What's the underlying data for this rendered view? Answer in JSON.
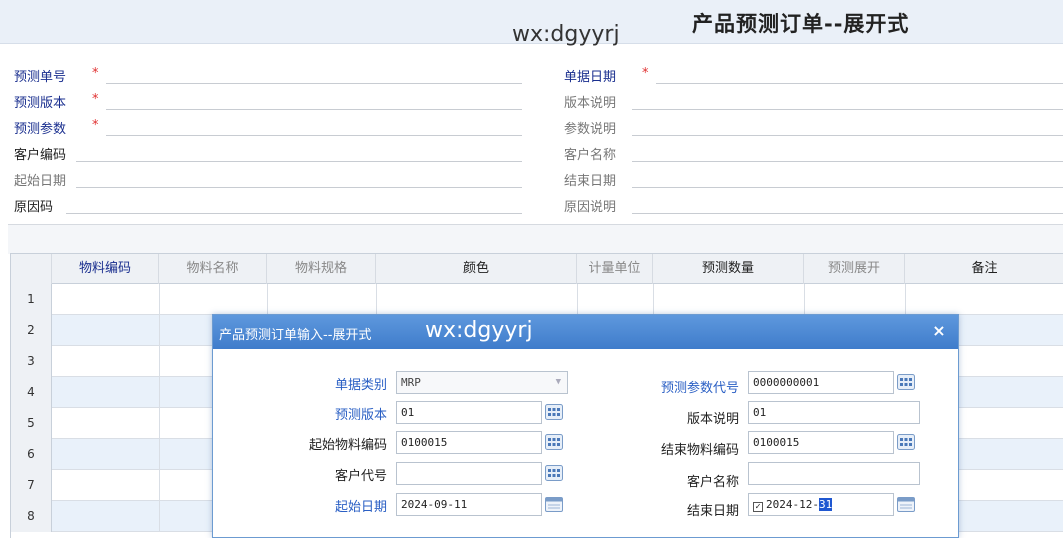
{
  "header": {
    "watermark": "wx:dgyyrj",
    "title": "产品预测订单--展开式"
  },
  "form": {
    "left": [
      {
        "label": "预测单号",
        "required": true
      },
      {
        "label": "预测版本",
        "required": true
      },
      {
        "label": "预测参数",
        "required": true
      },
      {
        "label": "客户编码",
        "required": false
      },
      {
        "label": "起始日期",
        "required": false
      },
      {
        "label": "原因码",
        "required": false
      }
    ],
    "right": [
      {
        "label": "单据日期",
        "required": true
      },
      {
        "label": "版本说明",
        "required": false
      },
      {
        "label": "参数说明",
        "required": false
      },
      {
        "label": "客户名称",
        "required": false
      },
      {
        "label": "结束日期",
        "required": false
      },
      {
        "label": "原因说明",
        "required": false
      }
    ],
    "required_mark": "*"
  },
  "grid": {
    "columns": [
      "物料编码",
      "物料名称",
      "物料规格",
      "颜色",
      "计量单位",
      "预测数量",
      "预测展开",
      "备注"
    ],
    "row_numbers": [
      "1",
      "2",
      "3",
      "4",
      "5",
      "6",
      "7",
      "8"
    ]
  },
  "dialog": {
    "title": "产品预测订单输入--展开式",
    "watermark": "wx:dgyyrj",
    "close_icon": "×",
    "fields": {
      "doc_type_label": "单据类别",
      "doc_type_value": "MRP",
      "forecast_version_label": "预测版本",
      "forecast_version_value": "01",
      "start_material_label": "起始物料编码",
      "start_material_value": "0100015",
      "customer_code_label": "客户代号",
      "customer_code_value": "",
      "start_date_label": "起始日期",
      "start_date_value": "2024-09-11",
      "param_code_label": "预测参数代号",
      "param_code_value": "0000000001",
      "version_desc_label": "版本说明",
      "version_desc_value": "01",
      "end_material_label": "结束物料编码",
      "end_material_value": "0100015",
      "customer_name_label": "客户名称",
      "customer_name_value": "",
      "end_date_label": "结束日期",
      "end_date_value_prefix": "2024-12-",
      "end_date_value_selected": "31",
      "end_date_checked": true
    }
  },
  "colors": {
    "required_label": "#1a2f8f",
    "dialog_label_blue": "#2a5fc4",
    "required_star": "#e03030",
    "dialog_title_bg": "#4f8ad4",
    "grid_alt_row": "#e9f1fa"
  }
}
